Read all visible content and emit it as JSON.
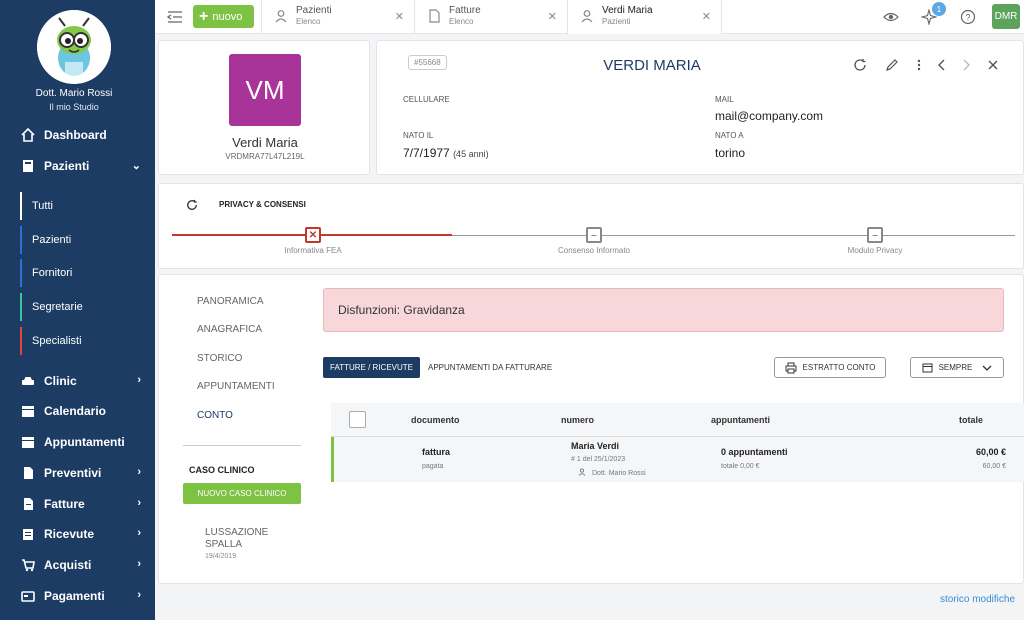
{
  "sidebar": {
    "doctor_name": "Dott. Mario Rossi",
    "studio": "Il mio Studio",
    "items": [
      {
        "label": "Dashboard",
        "icon": "home-icon"
      },
      {
        "label": "Pazienti",
        "icon": "user-card-icon"
      },
      {
        "label": "Clinic",
        "icon": "car-icon"
      },
      {
        "label": "Calendario",
        "icon": "calendar-icon"
      },
      {
        "label": "Appuntamenti",
        "icon": "calendar-check-icon"
      },
      {
        "label": "Preventivi",
        "icon": "document-icon"
      },
      {
        "label": "Fatture",
        "icon": "invoice-icon"
      },
      {
        "label": "Ricevute",
        "icon": "receipt-icon"
      },
      {
        "label": "Acquisti",
        "icon": "cart-icon"
      },
      {
        "label": "Pagamenti",
        "icon": "card-icon"
      }
    ],
    "subitems": [
      {
        "label": "Tutti",
        "color": "#ffffff"
      },
      {
        "label": "Pazienti",
        "color": "#2f6fd6"
      },
      {
        "label": "Fornitori",
        "color": "#2f6fd6"
      },
      {
        "label": "Segretarie",
        "color": "#3cc3a2"
      },
      {
        "label": "Specialisti",
        "color": "#e0443c"
      }
    ]
  },
  "topbar": {
    "new_label": "nuovo",
    "tabs": [
      {
        "title": "Pazienti",
        "subtitle": "Elenco"
      },
      {
        "title": "Fatture",
        "subtitle": "Elenco"
      },
      {
        "title": "Verdi Maria",
        "subtitle": "Pazienti"
      }
    ],
    "notification_count": "1",
    "user_initials": "DMR"
  },
  "patient": {
    "initials": "VM",
    "name": "Verdi Maria",
    "fiscal_code": "VRDMRA77L47L219L",
    "id": "#55668",
    "title": "VERDI MARIA",
    "fields": {
      "cellulare_label": "CELLULARE",
      "mail_label": "MAIL",
      "mail_value": "mail@company.com",
      "nato_il_label": "NATO IL",
      "nato_il_value": "7/7/1977",
      "age": "(45 anni)",
      "nato_a_label": "NATO A",
      "nato_a_value": "torino"
    }
  },
  "privacy": {
    "title": "PRIVACY & CONSENSI",
    "steps": [
      {
        "label": "Informativa FEA",
        "status": "error"
      },
      {
        "label": "Consenso Informato",
        "status": "pending"
      },
      {
        "label": "Modulo Privacy",
        "status": "pending"
      }
    ],
    "colors": {
      "error": "#c0392b",
      "pending": "#888888"
    }
  },
  "main": {
    "side_nav": [
      "PANORAMICA",
      "ANAGRAFICA",
      "STORICO",
      "APPUNTAMENTI",
      "CONTO"
    ],
    "active_side_nav": "CONTO",
    "caso_clinico_label": "CASO CLINICO",
    "new_caso_label": "NUOVO CASO CLINICO",
    "caso": {
      "name": "LUSSAZIONE SPALLA",
      "date": "19/4/2019"
    },
    "alert": "Disfunzioni: Gravidanza",
    "tab_active": "FATTURE / RICEVUTE",
    "tab_other": "APPUNTAMENTI DA FATTURARE",
    "btn_estratto": "ESTRATTO CONTO",
    "btn_sempre": "SEMPRE",
    "table": {
      "headers": [
        "documento",
        "numero",
        "appuntamenti",
        "totale"
      ],
      "rows": [
        {
          "doc": "fattura",
          "doc_status": "pagata",
          "name": "Maria Verdi",
          "num": "# 1",
          "num_date": "del 25/1/2023",
          "doctor": "Dott. Mario Rossi",
          "appts": "0 appuntamenti",
          "appts_total": "totale 0,00 €",
          "total": "60,00 €",
          "total_sub": "60,00 €"
        }
      ]
    }
  },
  "footer": {
    "link": "storico modifiche"
  }
}
